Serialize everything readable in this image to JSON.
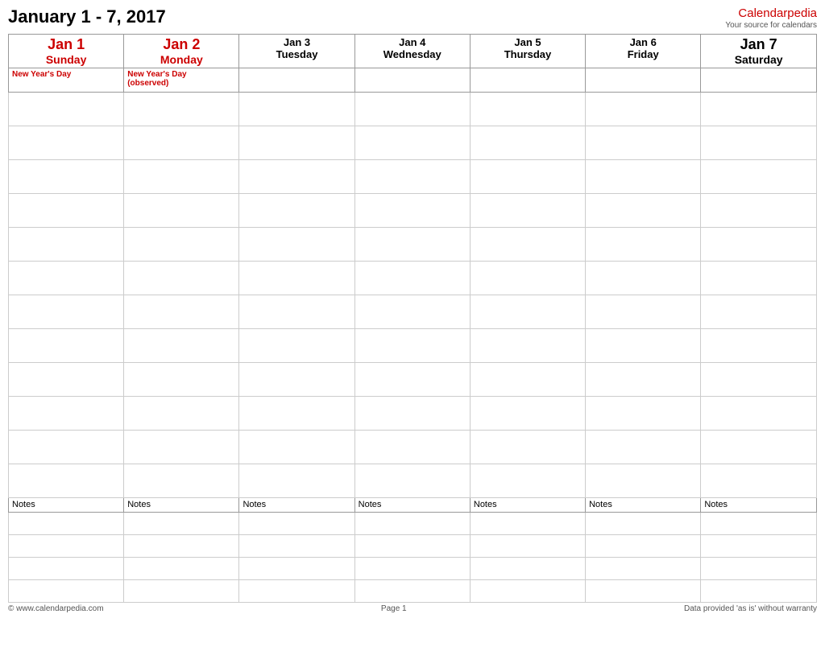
{
  "header": {
    "title": "January 1 - 7, 2017",
    "brand_name": "Calendar",
    "brand_name_red": "pedia",
    "brand_sub": "Your source for calendars"
  },
  "days": [
    {
      "num": "Jan 1",
      "num_color": "red",
      "weekday": "Sunday",
      "weekday_bold": true,
      "weekday_color": "red"
    },
    {
      "num": "Jan 2",
      "num_color": "red",
      "weekday": "Monday",
      "weekday_bold": true,
      "weekday_color": "red"
    },
    {
      "num": "Jan 3",
      "num_color": "black",
      "weekday": "Tuesday",
      "weekday_bold": false,
      "weekday_color": "black"
    },
    {
      "num": "Jan 4",
      "num_color": "black",
      "weekday": "Wednesday",
      "weekday_bold": false,
      "weekday_color": "black"
    },
    {
      "num": "Jan 5",
      "num_color": "black",
      "weekday": "Thursday",
      "weekday_bold": false,
      "weekday_color": "black"
    },
    {
      "num": "Jan 6",
      "num_color": "black",
      "weekday": "Friday",
      "weekday_bold": false,
      "weekday_color": "black"
    },
    {
      "num": "Jan 7",
      "num_color": "black",
      "weekday": "Saturday",
      "weekday_bold": true,
      "weekday_color": "black"
    }
  ],
  "holidays": [
    "New Year's Day",
    "New Year's Day (observed)",
    "",
    "",
    "",
    "",
    ""
  ],
  "content_rows": 12,
  "notes_label": "Notes",
  "notes_rows": 3,
  "footer": {
    "left": "© www.calendarpedia.com",
    "center": "Page 1",
    "right": "Data provided 'as is' without warranty"
  }
}
